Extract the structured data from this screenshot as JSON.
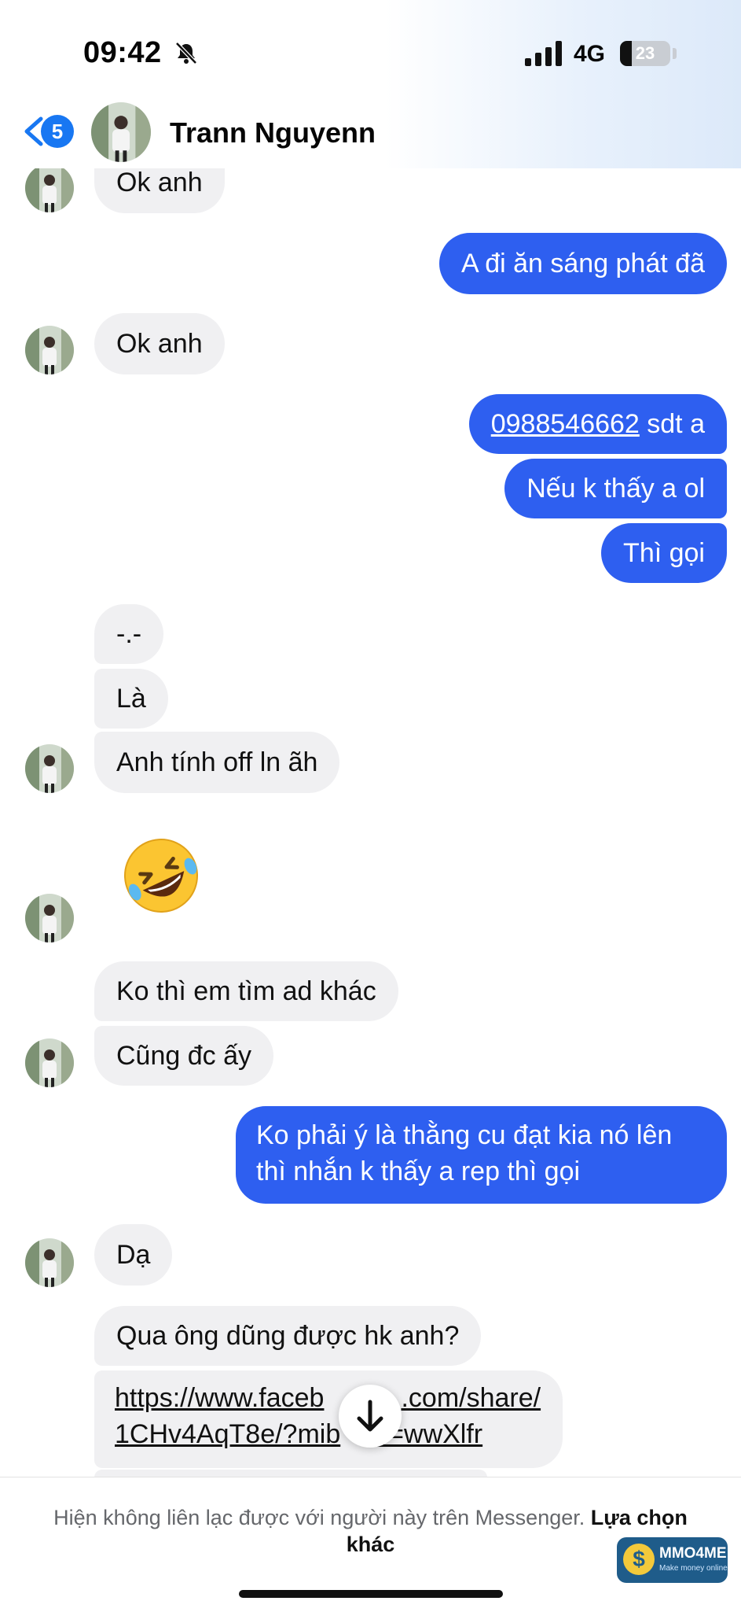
{
  "status_bar": {
    "time": "09:42",
    "network": "4G",
    "battery": "23",
    "battery_level": 0.23
  },
  "header": {
    "back_badge": "5",
    "contact_name": "Trann Nguyenn"
  },
  "messages": [
    {
      "from": "them",
      "text": "Ok anh"
    },
    {
      "from": "me",
      "text": "A đi ăn sáng phát đã"
    },
    {
      "from": "them",
      "text": "Ok anh"
    },
    {
      "from": "me",
      "phone": "0988546662",
      "text": " sdt a"
    },
    {
      "from": "me",
      "text": "Nếu k thấy a ol"
    },
    {
      "from": "me",
      "text": "Thì gọi"
    },
    {
      "from": "them",
      "text": "-.-"
    },
    {
      "from": "them",
      "text": "Là"
    },
    {
      "from": "them",
      "text": "Anh tính off ln ãh"
    },
    {
      "from": "them",
      "emoji": "rolling-on-the-floor-laughing"
    },
    {
      "from": "them",
      "text": "Ko thì em tìm ad khác"
    },
    {
      "from": "them",
      "text": "Cũng đc ấy"
    },
    {
      "from": "me",
      "text": "Ko phải ý là thằng cu đạt kia nó lên thì nhắn k thấy a rep thì gọi"
    },
    {
      "from": "them",
      "text": "Dạ"
    },
    {
      "from": "them",
      "text": "Qua ông dũng được hk anh?"
    },
    {
      "from": "them",
      "link_part1": "https://www.faceb",
      "link_part2": "1CHv4AqT8e/?mib",
      "link_part3": ".com/share/",
      "link_part4": "d=wwXlfr"
    }
  ],
  "footer": {
    "notice": "Hiện không liên lạc được với người này trên Messenger.",
    "action": "Lựa chọn khác"
  },
  "watermark": {
    "name": "MMO4ME",
    "tagline": "Make money online",
    "coin": "$"
  },
  "colors": {
    "accent": "#1877f2",
    "outgoing_bubble": "#2e5ff0",
    "incoming_bubble": "#f0f0f2"
  }
}
